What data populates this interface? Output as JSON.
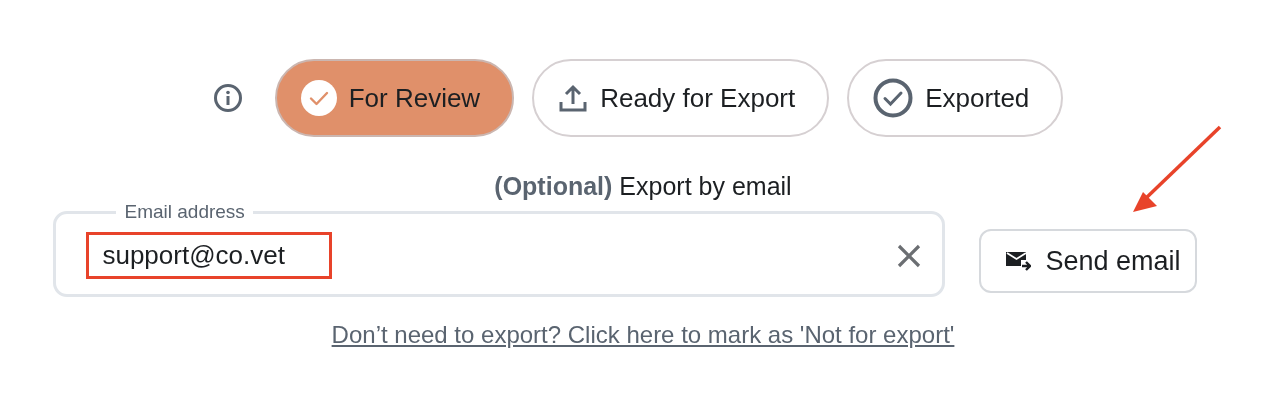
{
  "status_tabs": [
    {
      "label": "For Review",
      "selected": true
    },
    {
      "label": "Ready for Export",
      "selected": false
    },
    {
      "label": "Exported",
      "selected": false
    }
  ],
  "export_email": {
    "optional_label": "(Optional)",
    "heading": "Export by email",
    "field_label": "Email address",
    "value": "support@co.vet",
    "highlighted": true,
    "send_button": "Send email"
  },
  "not_for_export_link": "Don’t need to export? Click here to mark as 'Not for export'",
  "annotation_arrow": true
}
